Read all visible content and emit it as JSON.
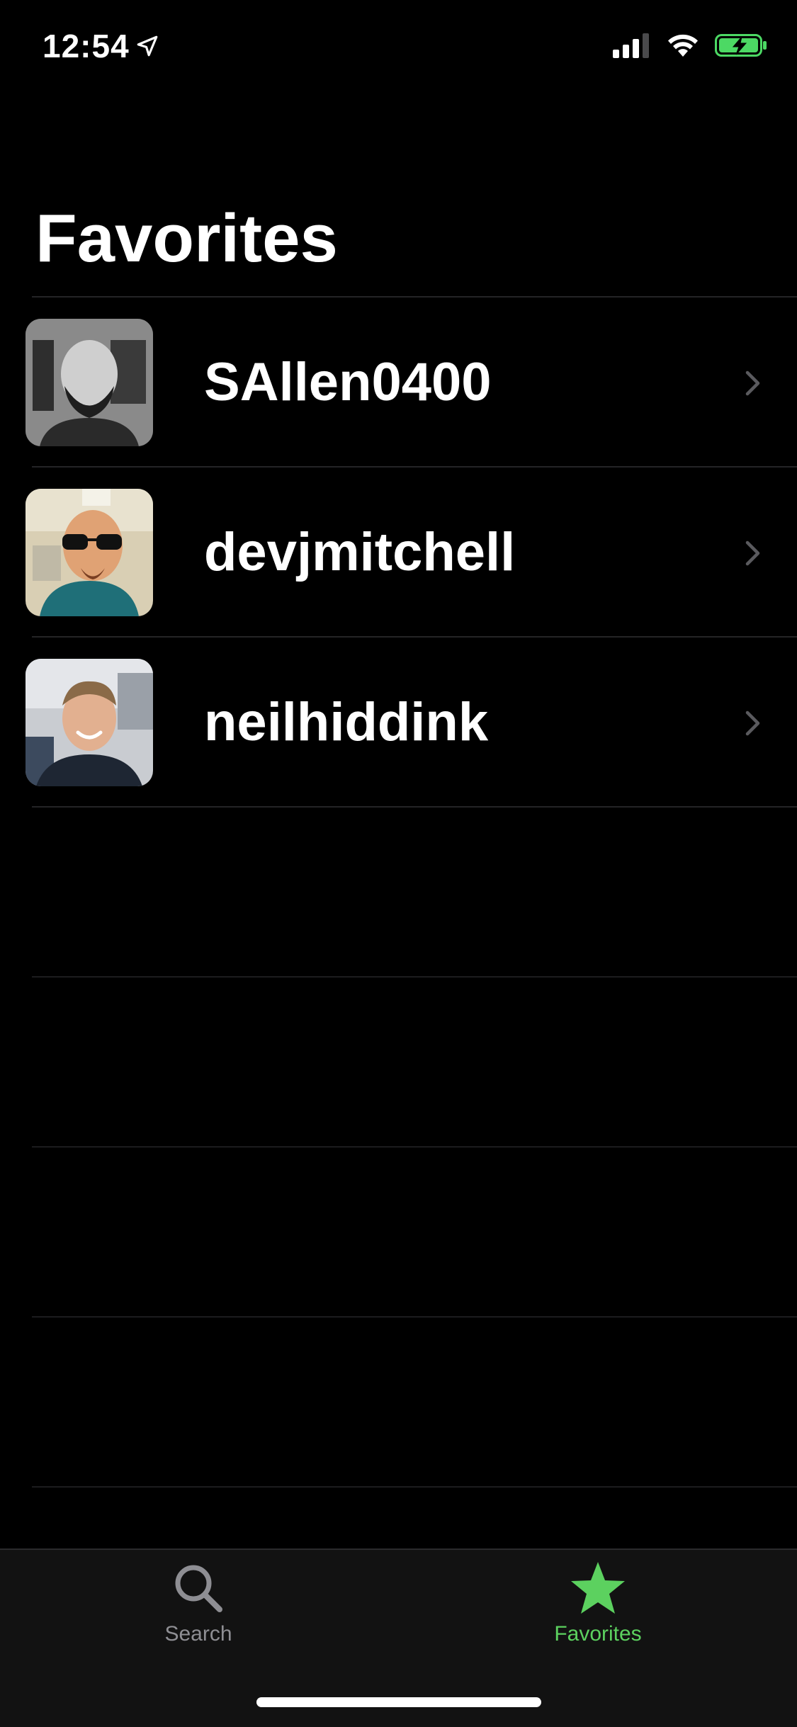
{
  "status_bar": {
    "time": "12:54",
    "icons": [
      "location-arrow-icon",
      "cellular-signal-icon",
      "wifi-icon",
      "battery-charging-icon"
    ],
    "battery_color": "#4cd964"
  },
  "page": {
    "title": "Favorites"
  },
  "favorites": [
    {
      "name": "SAllen0400",
      "avatar": "avatar-photo"
    },
    {
      "name": "devjmitchell",
      "avatar": "avatar-memoji"
    },
    {
      "name": "neilhiddink",
      "avatar": "avatar-photo"
    }
  ],
  "tab_bar": {
    "tabs": [
      {
        "label": "Search",
        "icon": "magnifying-glass-icon",
        "selected": false
      },
      {
        "label": "Favorites",
        "icon": "star-icon",
        "selected": true
      }
    ],
    "selected_color": "#5cd15f",
    "unselected_color": "#8e8e93"
  },
  "colors": {
    "background": "#000000",
    "separator": "#242426",
    "tab_bar_bg": "#121212"
  }
}
